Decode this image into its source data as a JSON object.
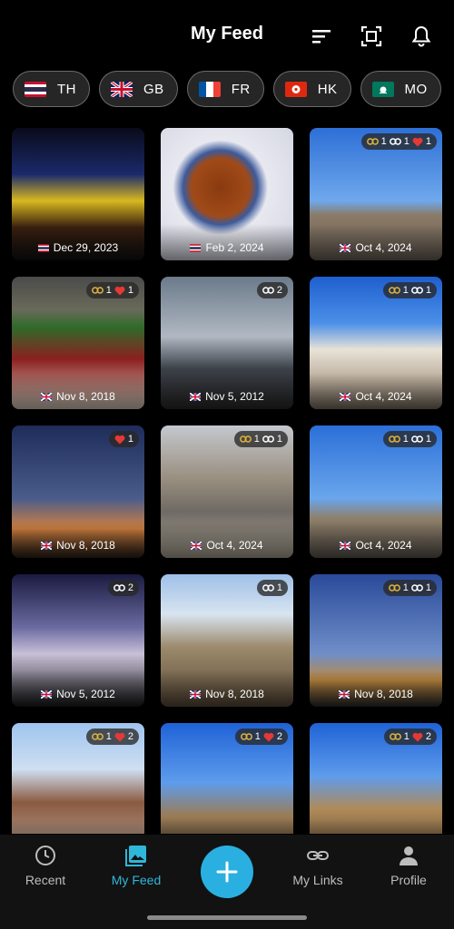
{
  "header": {
    "title": "My Feed",
    "icons": [
      "sort-icon",
      "focus-frame-icon",
      "bell-icon"
    ]
  },
  "filters": [
    {
      "code": "TH",
      "flag": "thailand-flag"
    },
    {
      "code": "GB",
      "flag": "uk-flag"
    },
    {
      "code": "FR",
      "flag": "france-flag"
    },
    {
      "code": "HK",
      "flag": "hong-kong-flag"
    },
    {
      "code": "MO",
      "flag": "macau-flag"
    }
  ],
  "photos": [
    {
      "date": "Dec 29, 2023",
      "flag": "thailand-flag",
      "badge": null
    },
    {
      "date": "Feb 2, 2024",
      "flag": "thailand-flag",
      "badge": null
    },
    {
      "date": "Oct 4, 2024",
      "flag": "uk-flag",
      "badge": {
        "link_a": "1",
        "link_b": "1",
        "hearts": "1"
      }
    },
    {
      "date": "Nov 8, 2018",
      "flag": "uk-flag",
      "badge": {
        "link_a": "1",
        "hearts": "1"
      }
    },
    {
      "date": "Nov 5, 2012",
      "flag": "uk-flag",
      "badge": {
        "link_b": "2"
      }
    },
    {
      "date": "Oct 4, 2024",
      "flag": "uk-flag",
      "badge": {
        "link_a": "1",
        "link_b": "1"
      }
    },
    {
      "date": "Nov 8, 2018",
      "flag": "uk-flag",
      "badge": {
        "hearts": "1"
      }
    },
    {
      "date": "Oct 4, 2024",
      "flag": "uk-flag",
      "badge": {
        "link_a": "1",
        "link_b": "1"
      }
    },
    {
      "date": "Oct 4, 2024",
      "flag": "uk-flag",
      "badge": {
        "link_a": "1",
        "link_b": "1"
      }
    },
    {
      "date": "Nov 5, 2012",
      "flag": "uk-flag",
      "badge": {
        "link_b": "2"
      }
    },
    {
      "date": "Nov 8, 2018",
      "flag": "uk-flag",
      "badge": {
        "link_b": "1"
      }
    },
    {
      "date": "Nov 8, 2018",
      "flag": "uk-flag",
      "badge": {
        "link_a": "1",
        "link_b": "1"
      }
    },
    {
      "date": "",
      "flag": "uk-flag",
      "badge": {
        "link_a": "1",
        "hearts": "2"
      }
    },
    {
      "date": "",
      "flag": "uk-flag",
      "badge": {
        "link_a": "1",
        "hearts": "2"
      }
    },
    {
      "date": "",
      "flag": "uk-flag",
      "badge": {
        "link_a": "1",
        "hearts": "2"
      }
    }
  ],
  "tabs": [
    {
      "label": "Recent",
      "icon": "clock-icon"
    },
    {
      "label": "My Feed",
      "icon": "gallery-icon"
    },
    {
      "label": "My Links",
      "icon": "link-icon"
    },
    {
      "label": "Profile",
      "icon": "person-icon"
    }
  ],
  "fab": {
    "icon": "plus-icon"
  },
  "colors": {
    "accent": "#2eb7d9",
    "fab": "#2ab0e0",
    "background": "#000000"
  }
}
